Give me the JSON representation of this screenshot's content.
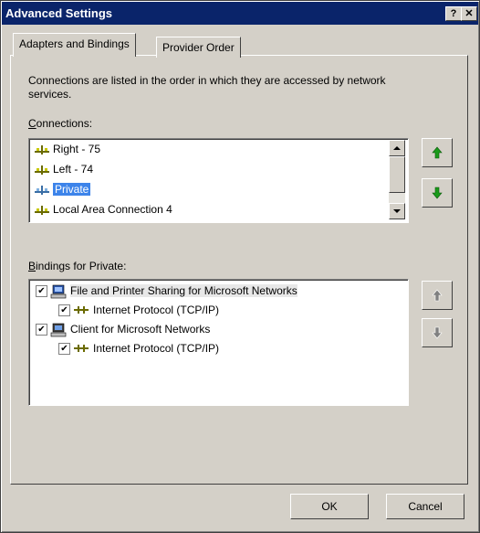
{
  "window": {
    "title": "Advanced Settings",
    "help_label": "?",
    "close_label": "✕"
  },
  "tabs": [
    {
      "label": "Adapters and Bindings",
      "active": true
    },
    {
      "label": "Provider Order",
      "active": false
    }
  ],
  "description": "Connections are listed in the order in which they are accessed by network services.",
  "connections": {
    "label": "Connections:",
    "label_accel": "C",
    "label_rest": "onnections:",
    "items": [
      {
        "label": "Right - 75"
      },
      {
        "label": "Left - 74"
      },
      {
        "label": "Private",
        "selected": true
      },
      {
        "label": "Local Area Connection 4"
      }
    ]
  },
  "bindings": {
    "label": "Bindings for Private:",
    "label_accel": "B",
    "label_rest": "indings for Private:",
    "items": [
      {
        "label": "File and Printer Sharing for Microsoft Networks",
        "checked": true,
        "icon": "file-printer-sharing-icon",
        "level": 0
      },
      {
        "label": "Internet Protocol (TCP/IP)",
        "checked": true,
        "icon": "protocol-icon",
        "level": 1
      },
      {
        "label": "Client for Microsoft Networks",
        "checked": true,
        "icon": "client-icon",
        "level": 0
      },
      {
        "label": "Internet Protocol (TCP/IP)",
        "checked": true,
        "icon": "protocol-icon",
        "level": 1
      }
    ]
  },
  "buttons": {
    "ok": "OK",
    "cancel": "Cancel"
  },
  "colors": {
    "titlebar": "#0a246a",
    "selection": "#3d84ea",
    "arrow_active": "#1a9a1a",
    "arrow_disabled": "#808080",
    "face": "#d4d0c8"
  }
}
